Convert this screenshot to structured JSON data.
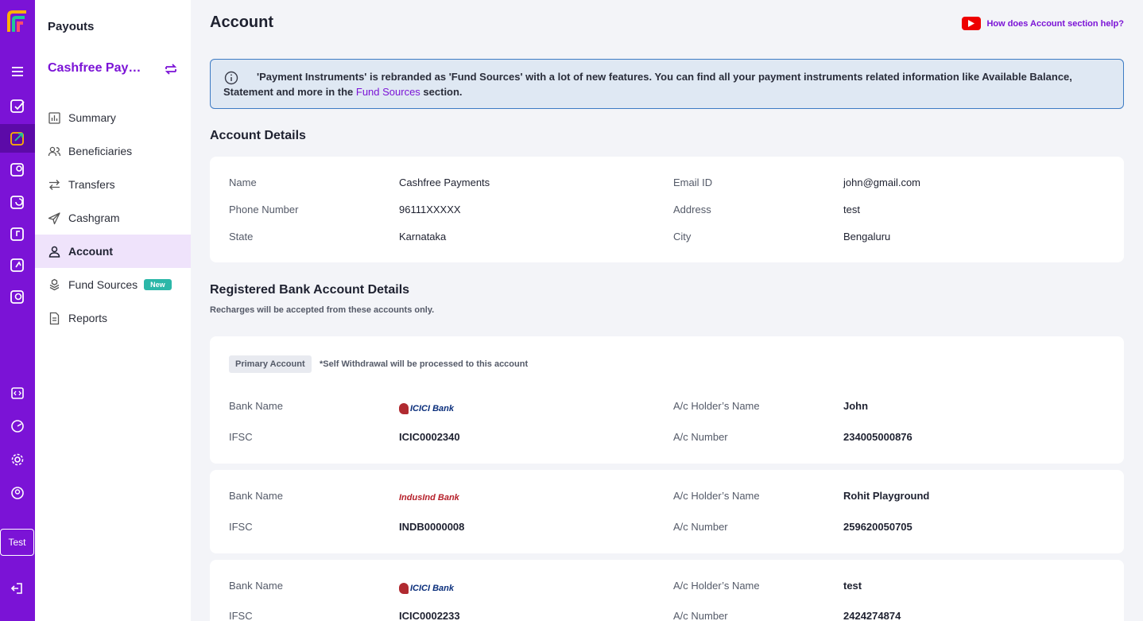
{
  "sidebar": {
    "title": "Payouts",
    "merchant": "Cashfree Payments",
    "items": [
      {
        "label": "Summary",
        "icon": "bar-chart-icon"
      },
      {
        "label": "Beneficiaries",
        "icon": "users-icon"
      },
      {
        "label": "Transfers",
        "icon": "arrows-icon"
      },
      {
        "label": "Cashgram",
        "icon": "send-icon"
      },
      {
        "label": "Account",
        "icon": "user-icon"
      },
      {
        "label": "Fund Sources",
        "icon": "stack-icon",
        "badge": "New"
      },
      {
        "label": "Reports",
        "icon": "document-icon"
      }
    ]
  },
  "rail": {
    "env_badge": "Test"
  },
  "header": {
    "title": "Account",
    "help_link": "How does Account section help?"
  },
  "info_banner": {
    "text_before": "'Payment Instruments' is rebranded as 'Fund Sources' with a lot of new features. You can find all your payment instruments related information like Available Balance, Statement and more in the ",
    "link": "Fund Sources",
    "text_after": " section."
  },
  "account_details": {
    "heading": "Account Details",
    "fields": {
      "name_label": "Name",
      "name": "Cashfree Payments",
      "email_label": "Email ID",
      "email": "john@gmail.com",
      "phone_label": "Phone Number",
      "phone": "96111XXXXX",
      "address_label": "Address",
      "address": "test",
      "state_label": "State",
      "state": "Karnataka",
      "city_label": "City",
      "city": "Bengaluru"
    }
  },
  "bank_section": {
    "heading": "Registered Bank Account Details",
    "note": "Recharges will be accepted from these accounts only.",
    "primary_tag": "Primary Account",
    "primary_note": "*Self Withdrawal will be processed to this account",
    "labels": {
      "bank": "Bank Name",
      "holder": "A/c Holder’s Name",
      "ifsc": "IFSC",
      "number": "A/c Number"
    },
    "accounts": [
      {
        "bank_logo_text": "ICICI Bank",
        "holder": "John",
        "ifsc": "ICIC0002340",
        "number": "234005000876"
      },
      {
        "bank_logo_text": "IndusInd Bank",
        "holder": "Rohit Playground",
        "ifsc": "INDB0000008",
        "number": "259620050705"
      },
      {
        "bank_logo_text": "ICICI Bank",
        "holder": "test",
        "ifsc": "ICIC0002233",
        "number": "2424274874"
      }
    ]
  },
  "colors": {
    "brand": "#7b13d6",
    "rail": "#7b13d6",
    "info_bg": "#dfe8f3",
    "info_border": "#3d7bc4",
    "new_badge": "#2cb7a8"
  }
}
